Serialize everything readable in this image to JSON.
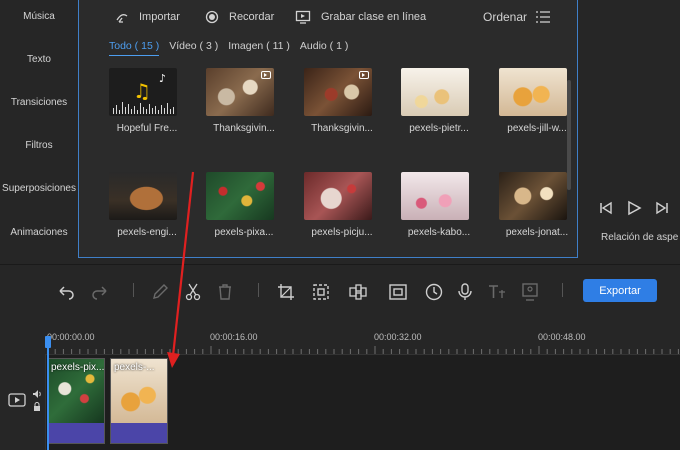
{
  "sidebar": {
    "items": [
      {
        "label": "Música"
      },
      {
        "label": "Texto"
      },
      {
        "label": "Transiciones"
      },
      {
        "label": "Filtros"
      },
      {
        "label": "Superposiciones"
      },
      {
        "label": "Animaciones"
      }
    ]
  },
  "media_toolbar": {
    "import_label": "Importar",
    "record_label": "Recordar",
    "record_class_label": "Grabar clase en línea",
    "sort_label": "Ordenar"
  },
  "tabs": [
    {
      "label": "Todo ( 15 )",
      "active": true
    },
    {
      "label": "Vídeo ( 3 )",
      "active": false
    },
    {
      "label": "Imagen ( 11 )",
      "active": false
    },
    {
      "label": "Audio ( 1 )",
      "active": false
    }
  ],
  "media_items": [
    {
      "label": "Hopeful Fre...",
      "kind": "audio"
    },
    {
      "label": "Thanksgivin...",
      "kind": "video"
    },
    {
      "label": "Thanksgivin...",
      "kind": "video"
    },
    {
      "label": "pexels-pietr...",
      "kind": "image"
    },
    {
      "label": "pexels-jill-w...",
      "kind": "image"
    },
    {
      "label": "pexels-engi...",
      "kind": "image"
    },
    {
      "label": "pexels-pixa...",
      "kind": "image"
    },
    {
      "label": "pexels-picju...",
      "kind": "image"
    },
    {
      "label": "pexels-kabo...",
      "kind": "image"
    },
    {
      "label": "pexels-jonat...",
      "kind": "image"
    }
  ],
  "preview": {
    "aspect_label": "Relación de aspe"
  },
  "edit_toolbar": {
    "export_label": "Exportar",
    "icons": [
      "undo-icon",
      "redo-icon",
      "pen-icon",
      "scissors-icon",
      "trash-icon",
      "crop-icon",
      "resize-icon",
      "mosaic-icon",
      "frame-icon",
      "clock-icon",
      "mic-icon",
      "text-icon",
      "image-icon"
    ]
  },
  "timeline": {
    "time_labels": [
      "00:00:00.00",
      "00:00:16.00",
      "00:00:32.00",
      "00:00:48.00"
    ],
    "clips": [
      {
        "label": "pexels-pix..."
      },
      {
        "label": "pexels-..."
      }
    ]
  },
  "colors": {
    "accent": "#2f7ee5",
    "panel_border": "#3f7fc8",
    "clip_bar": "#4b45a8",
    "annotation_arrow": "#e02020"
  }
}
